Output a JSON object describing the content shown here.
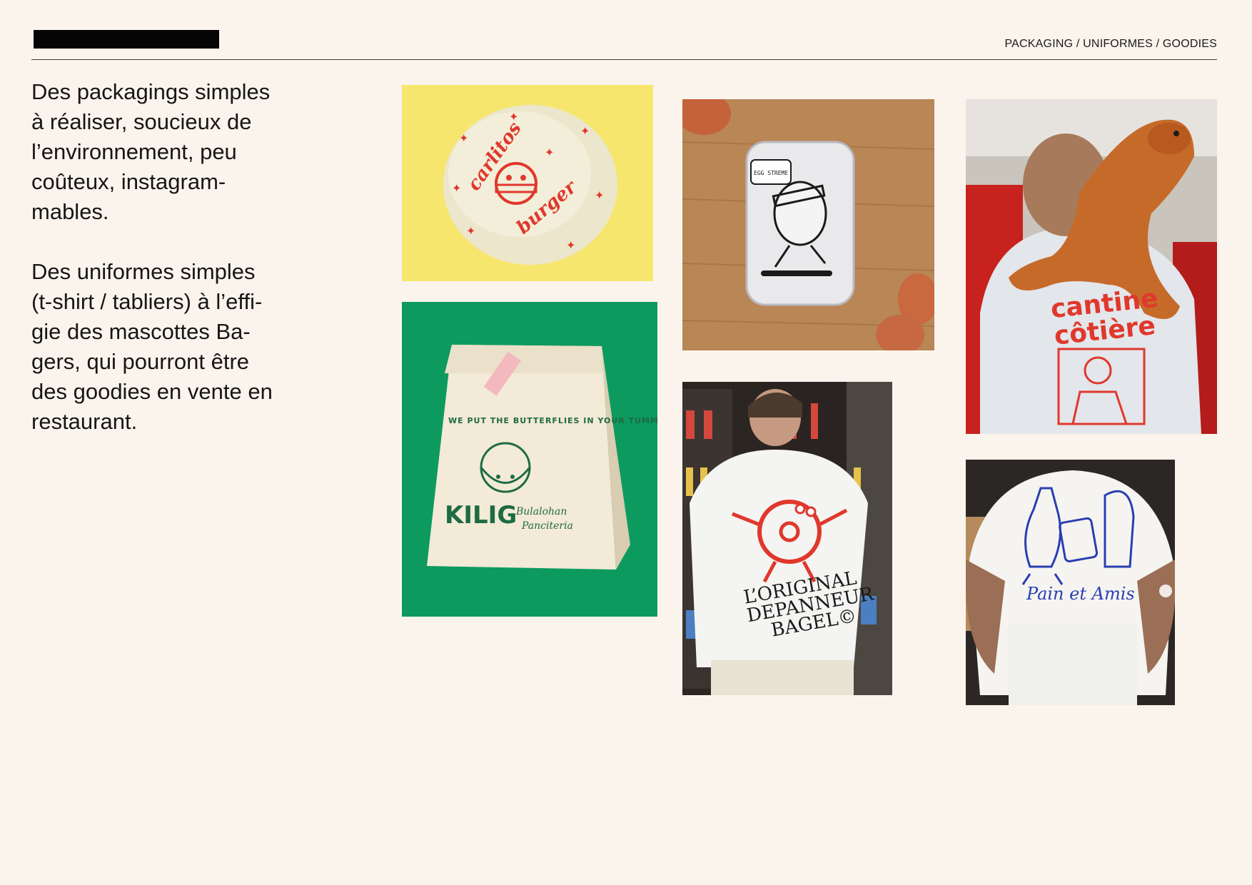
{
  "header": {
    "section_nav": "PACKAGING / UNIFORMES / GOODIES"
  },
  "intro": {
    "paragraph_1": "Des packagings simples\nà réaliser, soucieux de\nl’environnement, peu\ncoûteux, instagram-\nmables.",
    "paragraph_2": "Des uniformes simples\n(t-shirt / tabliers) à l’effi-\ngie des mascottes Ba-\ngers, qui pourront être\ndes goodies en vente en\nrestaurant."
  },
  "gallery": {
    "burger_wrap": {
      "line1": "carlitos",
      "line2": "burger"
    },
    "egg_box": {
      "speech": "EGG STREME"
    },
    "dog_shirt": {
      "line1": "cantine",
      "line2": "côtière"
    },
    "paper_bag": {
      "arc": "WE PUT THE BUTTERFLIES IN YOUR TUMMY",
      "brand": "KILIG",
      "sub1": "Bulalohan",
      "sub2": "Panciteria"
    },
    "bagel_shirt": {
      "line1": "L’ORIGINAL",
      "line2": "DEPANNEUR",
      "line3": "BAGEL©"
    },
    "bread_shirt": {
      "text": "Pain et Amis"
    }
  },
  "colors": {
    "background": "#fbf4ec",
    "accent_red": "#e0382c",
    "accent_green": "#0d9a5f",
    "accent_blue": "#2a3fb0",
    "accent_yellow": "#f6e66d"
  }
}
